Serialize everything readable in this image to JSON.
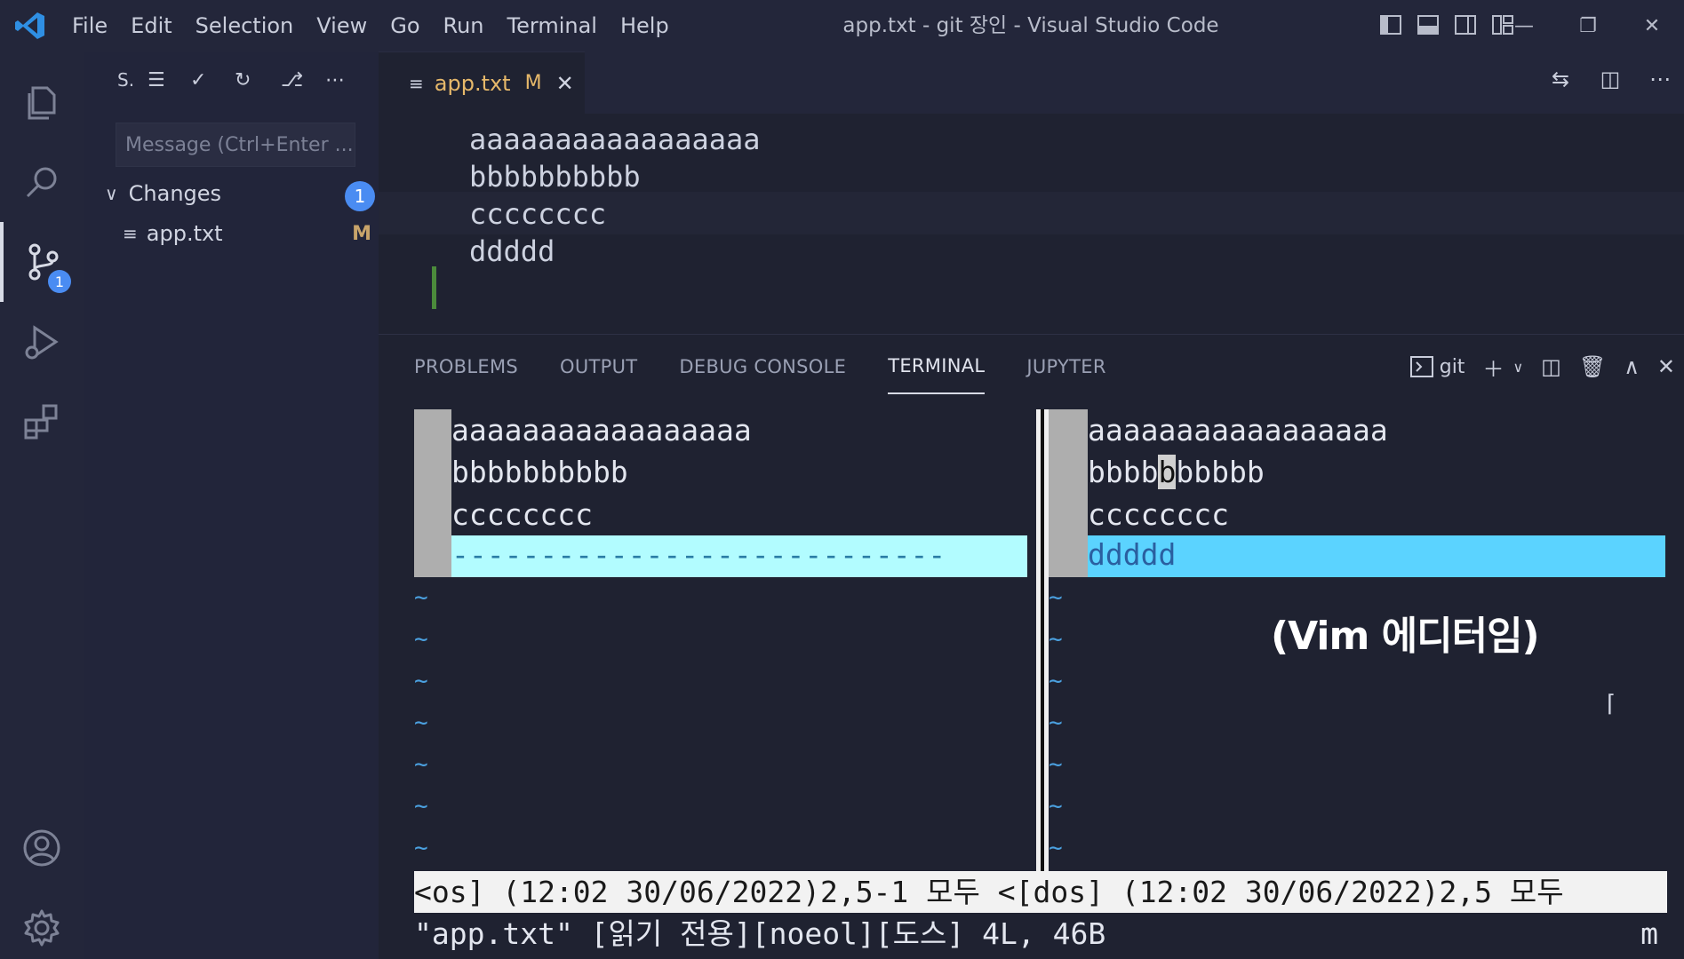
{
  "titlebar": {
    "menu": [
      "File",
      "Edit",
      "Selection",
      "View",
      "Go",
      "Run",
      "Terminal",
      "Help"
    ],
    "title": "app.txt - git 장인 - Visual Studio Code",
    "window_controls": [
      "minimize-icon",
      "restore-icon",
      "close-icon"
    ]
  },
  "activitybar": {
    "items": [
      "explorer-icon",
      "search-icon",
      "source-control-icon",
      "run-debug-icon",
      "extensions-icon"
    ],
    "scm_badge": "1",
    "bottom": [
      "account-icon",
      "settings-gear-icon"
    ]
  },
  "sidebar": {
    "toolbar_title": "S.",
    "commit_placeholder": "Message (Ctrl+Enter ...",
    "changes_label": "Changes",
    "changes_count": "1",
    "files": [
      {
        "name": "app.txt",
        "status": "M"
      }
    ]
  },
  "editor": {
    "tab": {
      "label": "app.txt",
      "status": "M"
    },
    "lines": [
      "aaaaaaaaaaaaaaaaa",
      "bbbbbbbbbb",
      "cccccccc",
      "ddddd"
    ]
  },
  "panel": {
    "tabs": [
      "PROBLEMS",
      "OUTPUT",
      "DEBUG CONSOLE",
      "TERMINAL",
      "JUPYTER"
    ],
    "active_tab": "TERMINAL",
    "terminal_name": "git"
  },
  "vim": {
    "left_lines": [
      "aaaaaaaaaaaaaaaaa",
      "bbbbbbbbbb",
      "cccccccc"
    ],
    "left_filler": "----------------------------",
    "right_lines": [
      "aaaaaaaaaaaaaaaaa",
      "bbbbbbbbbb",
      "cccccccc"
    ],
    "right_cursor_prefix": "bbbb",
    "right_cursor_char": "b",
    "right_cursor_suffix": "bbbbb",
    "right_added": "ddddd",
    "tilde": "~",
    "statusline": "<os] (12:02 30/06/2022)2,5-1 모두 <[dos] (12:02 30/06/2022)2,5 모두",
    "cmdline": "\"app.txt\" [읽기 전용][noeol][도스] 4L, 46B",
    "cmd_right": "m"
  },
  "caption": "(Vim 에디터임)",
  "colors": {
    "accent": "#4a8cf2",
    "modified": "#e6b86a",
    "vim_added_left": "#b2fcff",
    "vim_added_right": "#5bd3ff",
    "tilde": "#4ba1e0"
  }
}
